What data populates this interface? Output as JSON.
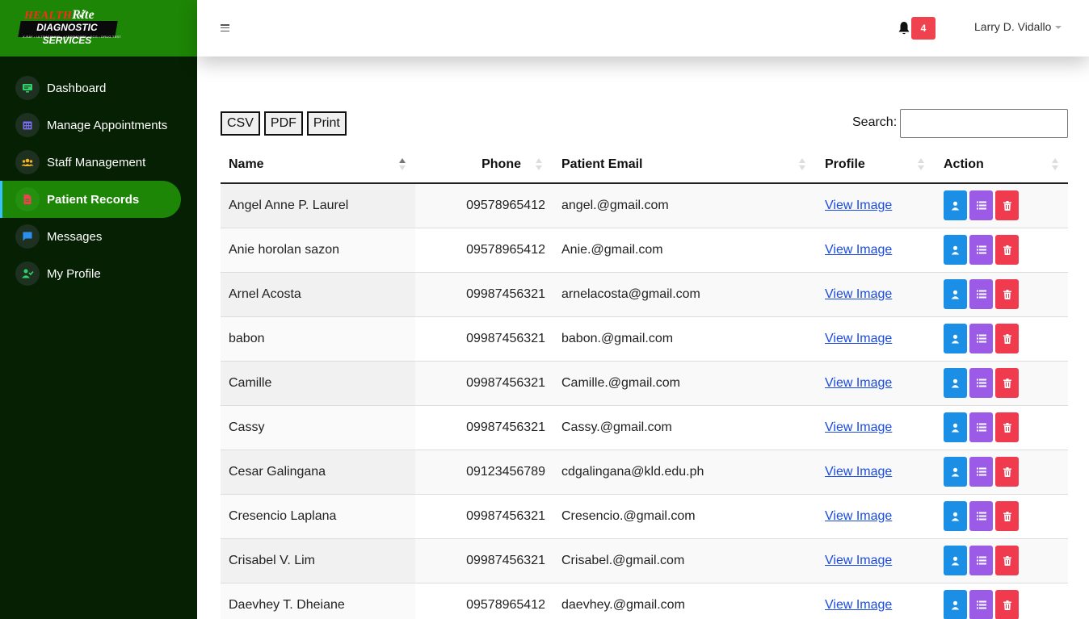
{
  "brand": {
    "line1": "HEALTH",
    "line1b": "Rite",
    "line2": "DIAGNOSTIC SERVICES",
    "line3": "X-RAY • ULTRASOUND • LABORATORY • ECG • DRUG TEST"
  },
  "sidebar": {
    "items": [
      {
        "label": "Dashboard",
        "icon": "monitor-icon",
        "icon_color": "#2fd26a"
      },
      {
        "label": "Manage Appointments",
        "icon": "calendar-icon",
        "icon_color": "#7a6cf0"
      },
      {
        "label": "Staff Management",
        "icon": "users-icon",
        "icon_color": "#f0b429"
      },
      {
        "label": "Patient Records",
        "icon": "file-icon",
        "icon_color": "#f0424e",
        "active": true
      },
      {
        "label": "Messages",
        "icon": "chat-icon",
        "icon_color": "#2b8ff0"
      },
      {
        "label": "My Profile",
        "icon": "user-check-icon",
        "icon_color": "#2fd26a"
      }
    ]
  },
  "header": {
    "notification_count": "4",
    "user_name": "Larry D. Vidallo"
  },
  "toolbar": {
    "csv": "CSV",
    "pdf": "PDF",
    "print": "Print",
    "search_label": "Search:",
    "search_value": ""
  },
  "table": {
    "columns": [
      "Name",
      "Phone",
      "Patient Email",
      "Profile",
      "Action"
    ],
    "rows": [
      {
        "name": "Angel Anne P. Laurel",
        "phone": "09578965412",
        "email": "angel.@gmail.com",
        "profile": "View Image"
      },
      {
        "name": "Anie horolan sazon",
        "phone": "09578965412",
        "email": "Anie.@gmail.com",
        "profile": "View Image"
      },
      {
        "name": "Arnel Acosta",
        "phone": "09987456321",
        "email": "arnelacosta@gmail.com",
        "profile": "View Image"
      },
      {
        "name": "babon",
        "phone": "09987456321",
        "email": "babon.@gmail.com",
        "profile": "View Image"
      },
      {
        "name": "Camille",
        "phone": "09987456321",
        "email": "Camille.@gmail.com",
        "profile": "View Image"
      },
      {
        "name": "Cassy",
        "phone": "09987456321",
        "email": "Cassy.@gmail.com",
        "profile": "View Image"
      },
      {
        "name": "Cesar Galingana",
        "phone": "09123456789",
        "email": "cdgalingana@kld.edu.ph",
        "profile": "View Image"
      },
      {
        "name": "Cresencio Laplana",
        "phone": "09987456321",
        "email": "Cresencio.@gmail.com",
        "profile": "View Image"
      },
      {
        "name": "Crisabel V. Lim",
        "phone": "09987456321",
        "email": "Crisabel.@gmail.com",
        "profile": "View Image"
      },
      {
        "name": "Daevhey T. Dheiane",
        "phone": "09578965412",
        "email": "daevhey.@gmail.com",
        "profile": "View Image"
      }
    ]
  },
  "colors": {
    "sidebar_bg": "#062004",
    "brand_green": "#1d8606",
    "btn_blue": "#1b8fe6",
    "btn_purple": "#9c5be6",
    "btn_red": "#ef3b4d",
    "badge_red": "#f0424e"
  }
}
